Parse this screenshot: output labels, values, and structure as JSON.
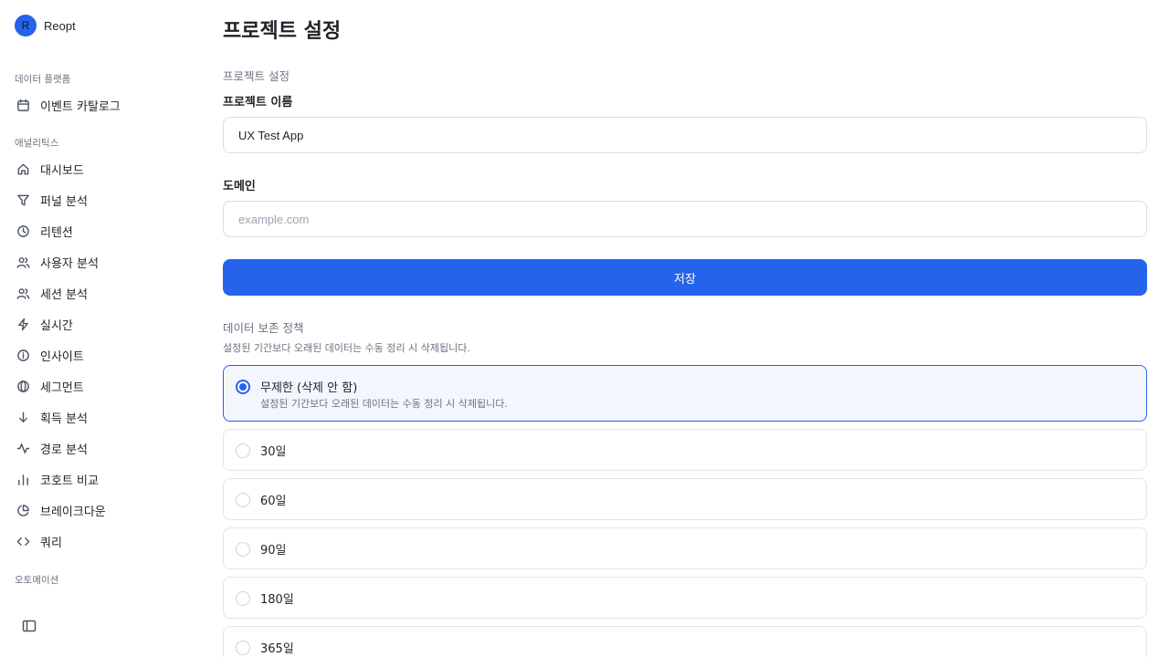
{
  "brand": {
    "initial": "R",
    "name": "Reopt"
  },
  "sidebar": {
    "sections": [
      {
        "title": "데이터 플랫폼"
      },
      {
        "title": "애널리틱스"
      },
      {
        "title": "오토메이션"
      }
    ],
    "items": [
      {
        "label": "이벤트 카탈로그",
        "icon": "calendar-icon"
      },
      {
        "label": "대시보드",
        "icon": "home-icon"
      },
      {
        "label": "퍼널 분석",
        "icon": "funnel-icon"
      },
      {
        "label": "리텐션",
        "icon": "clock-icon"
      },
      {
        "label": "사용자 분석",
        "icon": "users-icon"
      },
      {
        "label": "세션 분석",
        "icon": "users-icon"
      },
      {
        "label": "실시간",
        "icon": "lightning-icon"
      },
      {
        "label": "인사이트",
        "icon": "info-icon"
      },
      {
        "label": "세그먼트",
        "icon": "segment-icon"
      },
      {
        "label": "획득 분석",
        "icon": "arrow-down-icon"
      },
      {
        "label": "경로 분석",
        "icon": "activity-icon"
      },
      {
        "label": "코호트 비교",
        "icon": "bar-chart-icon"
      },
      {
        "label": "브레이크다운",
        "icon": "pie-chart-icon"
      },
      {
        "label": "쿼리",
        "icon": "code-icon"
      }
    ]
  },
  "main": {
    "title": "프로젝트 설정",
    "section_label": "프로젝트 설정",
    "project_name": {
      "label": "프로젝트 이름",
      "value": "UX Test App"
    },
    "domain": {
      "label": "도메인",
      "placeholder": "example.com"
    },
    "save_label": "저장",
    "retention": {
      "title": "데이터 보존 정책",
      "description": "설정된 기간보다 오래된 데이터는 수동 정리 시 삭제됩니다.",
      "options": [
        {
          "label": "무제한 (삭제 안 함)",
          "description": "설정된 기간보다 오래된 데이터는 수동 정리 시 삭제됩니다.",
          "selected": true
        },
        {
          "label": "30일",
          "selected": false
        },
        {
          "label": "60일",
          "selected": false
        },
        {
          "label": "90일",
          "selected": false
        },
        {
          "label": "180일",
          "selected": false
        },
        {
          "label": "365일",
          "selected": false
        }
      ]
    }
  },
  "colors": {
    "accent": "#2563eb",
    "selected_bg": "#f3f6fd",
    "border": "#e3e5e9"
  }
}
